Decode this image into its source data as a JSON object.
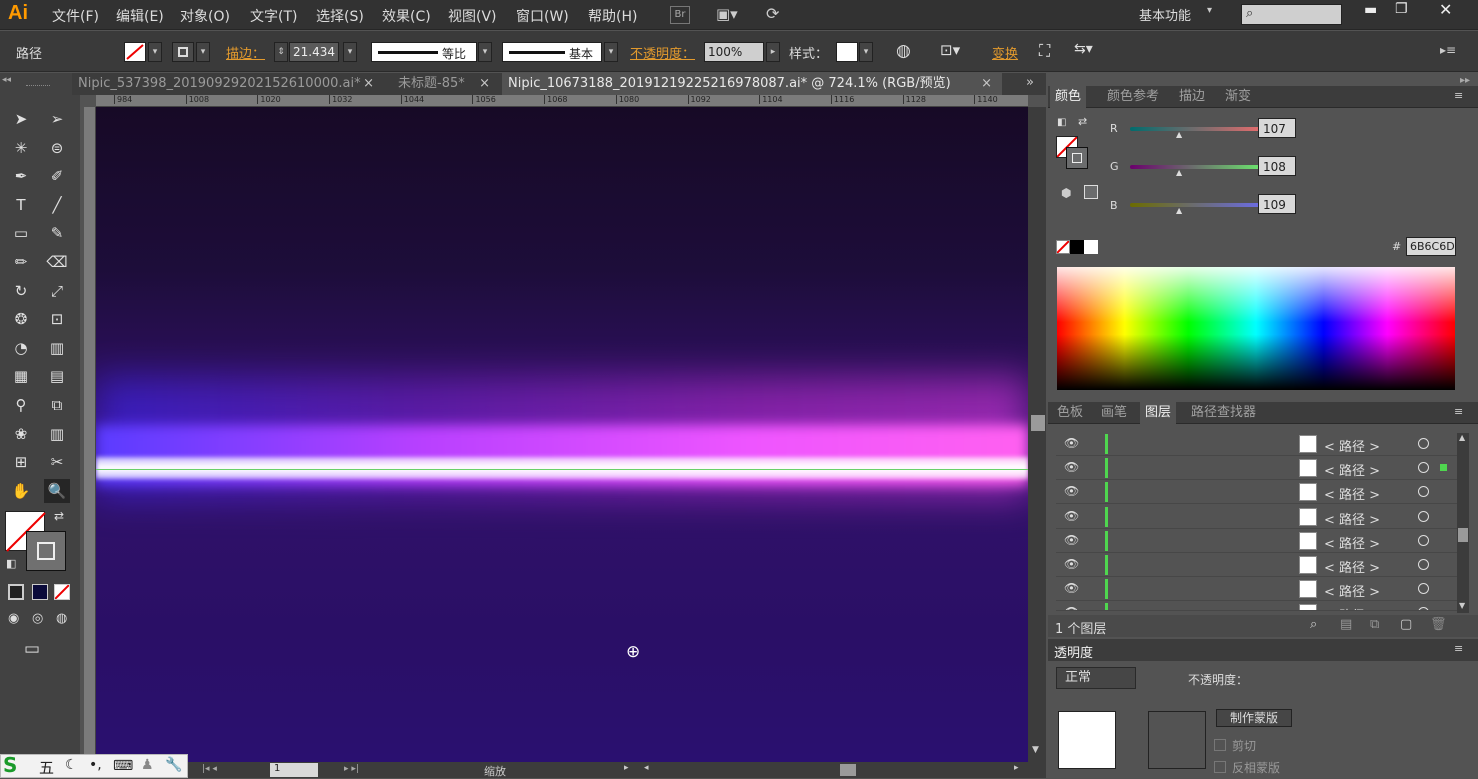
{
  "app": {
    "logo": "Ai"
  },
  "menu": [
    "文件(F)",
    "编辑(E)",
    "对象(O)",
    "文字(T)",
    "选择(S)",
    "效果(C)",
    "视图(V)",
    "窗口(W)",
    "帮助(H)"
  ],
  "menu_right": {
    "br": "Br",
    "workspace": "基本功能",
    "search_placeholder": ""
  },
  "control": {
    "object_type": "路径",
    "stroke_label": "描边：",
    "stroke_value": "21.434",
    "profile_label": "等比",
    "brush_label": "基本",
    "opacity_label": "不透明度：",
    "opacity_value": "100%",
    "style_label": "样式：",
    "transform_label": "变换"
  },
  "tabs": [
    {
      "label": "Nipic_537398_20190929202152610000.ai*",
      "close": "×"
    },
    {
      "label": "未标题-85*",
      "close": "×"
    },
    {
      "label": "Nipic_10673188_20191219225216978087.ai* @ 724.1% (RGB/预览)",
      "close": "×"
    }
  ],
  "ruler_ticks": [
    "984",
    "1008",
    "1020",
    "1032",
    "1044",
    "1056",
    "1068",
    "1080",
    "1092",
    "1104",
    "1116",
    "1128",
    "1140"
  ],
  "tools": [
    "selection-tool",
    "direct-selection-tool",
    "magic-wand-tool",
    "lasso-tool",
    "pen-tool",
    "curvature-tool",
    "type-tool",
    "line-tool",
    "rectangle-tool",
    "paintbrush-tool",
    "pencil-tool",
    "eraser-tool",
    "rotate-tool",
    "scale-tool",
    "warp-tool",
    "free-transform-tool",
    "shape-builder-tool",
    "perspective-tool",
    "mesh-tool",
    "gradient-tool",
    "eyedropper-tool",
    "blend-tool",
    "symbol-sprayer-tool",
    "column-graph-tool",
    "artboard-tool",
    "slice-tool",
    "hand-tool",
    "zoom-tool"
  ],
  "color_panel": {
    "tabs": [
      "颜色",
      "颜色参考",
      "描边",
      "渐变"
    ],
    "r_label": "R",
    "r_value": "107",
    "g_label": "G",
    "g_value": "108",
    "b_label": "B",
    "b_value": "109",
    "hex_label": "#",
    "hex_value": "6B6C6D"
  },
  "layers_panel": {
    "tabs": [
      "色板",
      "画笔",
      "图层",
      "路径查找器"
    ],
    "rows": [
      "< 路径 >",
      "< 路径 >",
      "< 路径 >",
      "< 路径 >",
      "< 路径 >",
      "< 路径 >",
      "< 路径 >",
      "< 路径 >"
    ],
    "footer": "1 个图层"
  },
  "transparency_panel": {
    "title": "透明度",
    "mode": "正常",
    "opacity_label": "不透明度：",
    "make_mask": "制作蒙版",
    "clip": "剪切",
    "invert": "反相蒙版"
  },
  "status": {
    "zoom_label": "缩放",
    "page": "1"
  },
  "taskbar": {
    "ime_label": "五"
  },
  "colors": {
    "accent": "#ff9a00",
    "layer_green": "#4fd64f",
    "glow_magenta": "#ee55ff",
    "glow_blue": "#5a3cff"
  }
}
